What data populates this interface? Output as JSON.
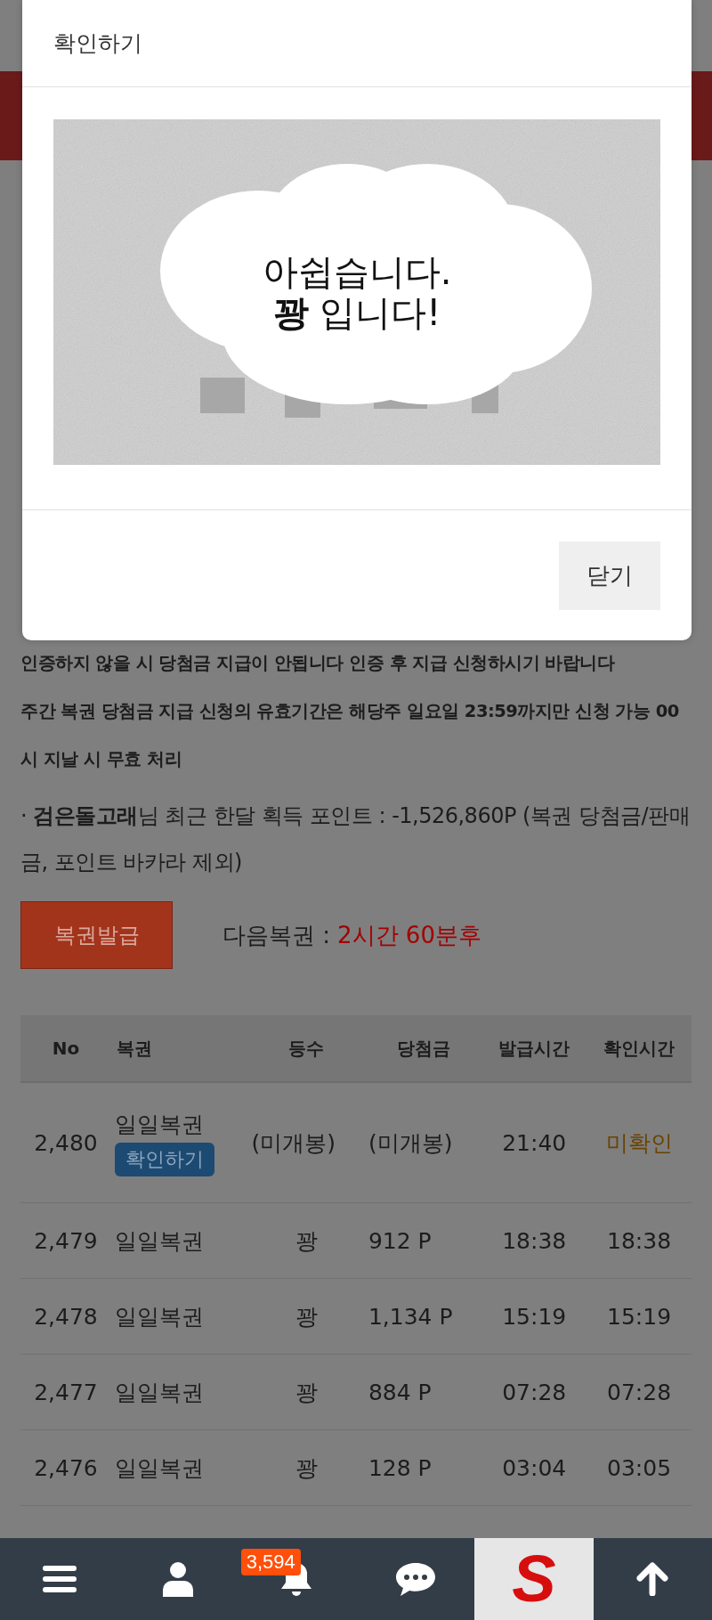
{
  "modal": {
    "title": "확인하기",
    "message_lines": [
      "아쉽습니다.",
      "**꽝** 입니다!"
    ],
    "close_button": "닫기"
  },
  "notices": [
    "인증하지 않을 시 당첨금 지급이 안됩니다 인증 후 지급 신청하시기 바랍니다",
    "주간 복권 당첨금 지급 신청의 유효기간은 해당주 일요일 23:59까지만 신청 가능 00시 지날 시 무효 처리"
  ],
  "points_text": "· **검은돌고래**님 최근 한달 획득 포인트 : -1,526,860P (복권 당첨금/판매금, 포인트 바카라 제외)",
  "issue_button": "복권발급",
  "next_label": "다음복권 :",
  "next_time": "2시간 60분후",
  "table": {
    "columns": [
      "No",
      "복권",
      "등수",
      "당첨금",
      "발급시간",
      "확인시간"
    ],
    "rows": [
      {
        "kind": "pending",
        "no": "2,480",
        "lottery": "일일복권",
        "action": "확인하기",
        "rank": "(미개봉)",
        "prize": "(미개봉)",
        "issued": "21:40",
        "confirmed": "미확인"
      },
      {
        "kind": "done",
        "no": "2,479",
        "lottery": "일일복권",
        "rank": "꽝",
        "prize": "912 P",
        "issued": "18:38",
        "confirmed": "18:38"
      },
      {
        "kind": "done",
        "no": "2,478",
        "lottery": "일일복권",
        "rank": "꽝",
        "prize": "1,134 P",
        "issued": "15:19",
        "confirmed": "15:19"
      },
      {
        "kind": "done",
        "no": "2,477",
        "lottery": "일일복권",
        "rank": "꽝",
        "prize": "884 P",
        "issued": "07:28",
        "confirmed": "07:28"
      },
      {
        "kind": "done",
        "no": "2,476",
        "lottery": "일일복권",
        "rank": "꽝",
        "prize": "128 P",
        "issued": "03:04",
        "confirmed": "03:05"
      }
    ]
  },
  "nav": [
    {
      "kind": "menu"
    },
    {
      "kind": "user"
    },
    {
      "kind": "bell",
      "badge": "3,594"
    },
    {
      "kind": "chat"
    },
    {
      "kind": "logo",
      "text": "S"
    },
    {
      "kind": "top"
    }
  ]
}
